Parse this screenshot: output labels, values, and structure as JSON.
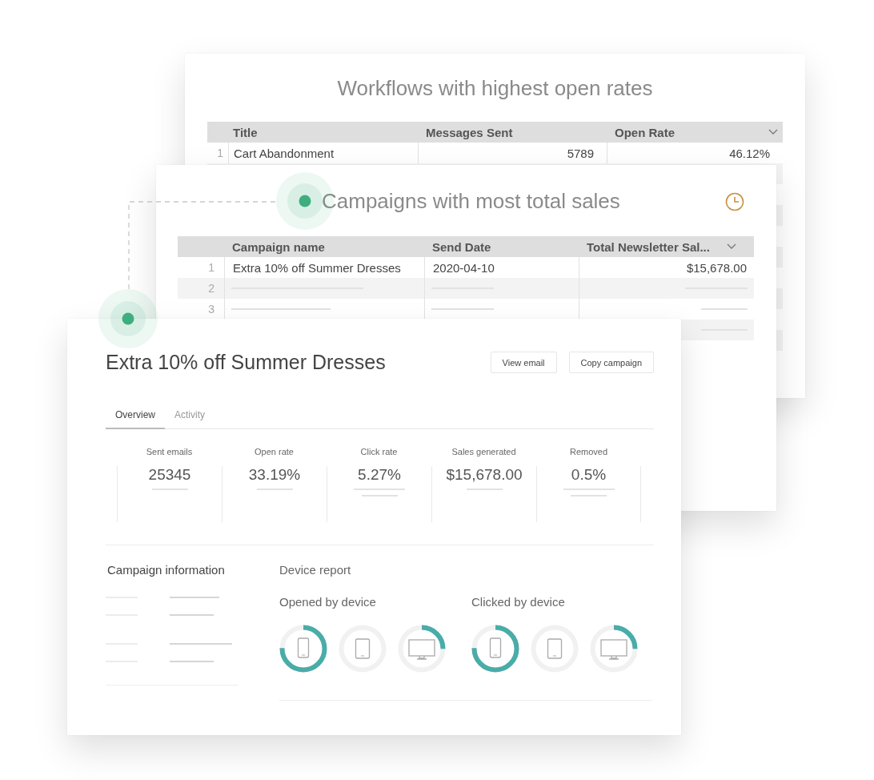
{
  "workflows_card": {
    "title": "Workflows with highest open rates",
    "columns": [
      "Title",
      "Messages Sent",
      "Open Rate"
    ],
    "rows": [
      {
        "index": "1",
        "cells": [
          "Cart Abandonment",
          "5789",
          "46.12%"
        ]
      }
    ]
  },
  "campaigns_card": {
    "title": "Campaigns with most total sales",
    "columns": [
      "Campaign name",
      "Send Date",
      "Total Newsletter Sal..."
    ],
    "rows": [
      {
        "index": "1",
        "cells": [
          "Extra 10% off Summer Dresses",
          "2020-04-10",
          "$15,678.00"
        ]
      },
      {
        "index": "2"
      },
      {
        "index": "3"
      }
    ]
  },
  "campaign_detail": {
    "title": "Extra 10% off Summer Dresses",
    "buttons": [
      "View email",
      "Copy campaign"
    ],
    "tabs": [
      {
        "label": "Overview",
        "selected": true
      },
      {
        "label": "Activity",
        "selected": false
      }
    ],
    "stats": [
      {
        "label": "Sent emails",
        "value": "25345"
      },
      {
        "label": "Open rate",
        "value": "33.19%"
      },
      {
        "label": "Click rate",
        "value": "5.27%"
      },
      {
        "label": "Sales generated",
        "value": "$15,678.00"
      },
      {
        "label": "Removed",
        "value": "0.5%"
      }
    ],
    "info_heading": "Campaign information",
    "device_report": {
      "heading": "Device report",
      "groups": [
        {
          "title": "Opened by device",
          "devices": [
            {
              "kind": "phone"
            },
            {
              "kind": "tablet"
            },
            {
              "kind": "desktop"
            }
          ]
        },
        {
          "title": "Clicked by device",
          "devices": [
            {
              "kind": "phone"
            },
            {
              "kind": "tablet"
            },
            {
              "kind": "desktop"
            }
          ]
        }
      ]
    }
  }
}
